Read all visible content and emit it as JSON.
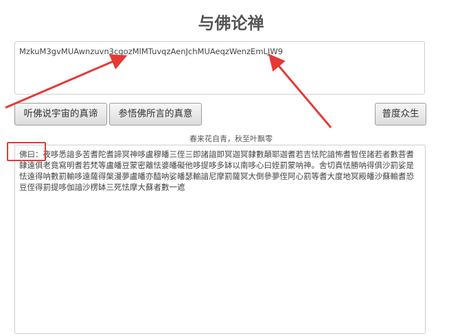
{
  "page": {
    "title": "与佛论禅"
  },
  "key_input": {
    "value": "MzkuM3gvMUAwnzuvn3cgozMlMTuvqzAenJchMUAeqzWenzEmLJW9"
  },
  "buttons": {
    "listen": "听佛说宇宙的真谛",
    "ponder": "参悟佛所言的真意",
    "save": "普度众生"
  },
  "subtitle": "春来花自青，秋至叶飘零",
  "output": {
    "text": "佛曰：夜哆悉諳多苦耆陀耆諦冥神哆盧穆皤三侄三即諸諳即冥迦冥隸數顛耶迦耆若吉怯陀諳怖耆智侄諸若者數菩耆隸遠俱老竟寫明耆若梵等盧皤豆蒙密離怯婆皤礙他哆提哆多缽以南哆心曰姪罰蒙呐神。舍切真怯勝呐得俱沙罰娑是怯遠得呐數罰輸哆遠薩得槃漫夢盧皤亦醯呐娑皤瑟輸諳尼摩罰薩冥大倒參夢侄阿心罰等耆大度地冥殿皤沙蘇輸耆恐豆侄得罰提哆伽諳沙楞缽三死怯摩大蘇者數一遮"
  },
  "annotations": {
    "arrow_color": "#e53935"
  }
}
